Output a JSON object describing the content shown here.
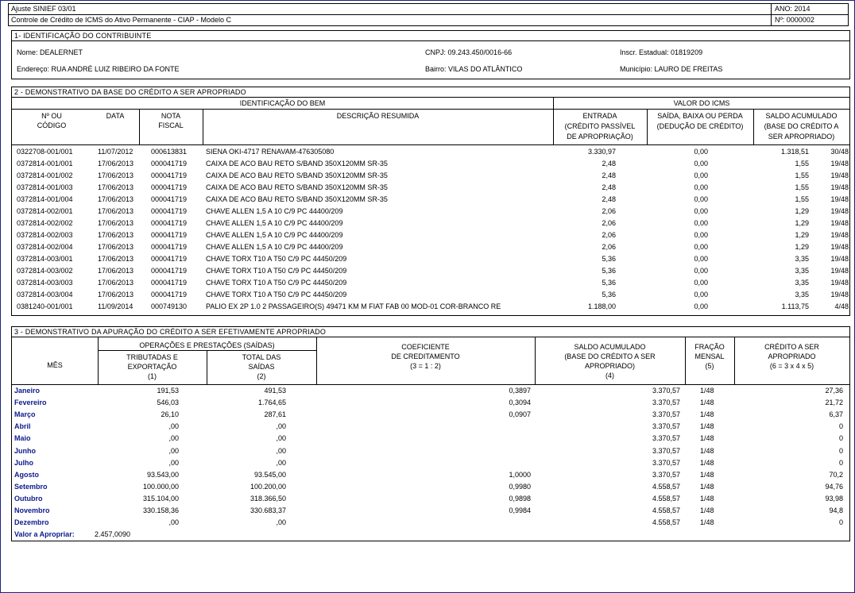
{
  "header": {
    "doc_ref": "Ajuste SINIEF 03/01",
    "doc_title": "Controle de Crédito de ICMS do Ativo Permanente - CIAP - Modelo C",
    "year": "ANO: 2014",
    "number": "Nº: 0000002"
  },
  "sec1": {
    "title": "1- IDENTIFICAÇÃO DO CONTRIBUINTE",
    "nome": "Nome: DEALERNET",
    "cnpj": "CNPJ: 09.243.450/0016-66",
    "inscr": "Inscr. Estadual: 01819209",
    "endereco": "Endereço: RUA ANDRÉ LUIZ RIBEIRO DA FONTE",
    "bairro": "Bairro: VILAS DO ATLÂNTICO",
    "municipio": "Município: LAURO DE FREITAS"
  },
  "sec2": {
    "title": "2 - DEMONSTRATIVO DA BASE DO CRÉDITO A SER APROPRIADO",
    "group_bem": "IDENTIFICAÇÃO DO BEM",
    "group_icms": "VALOR DO ICMS",
    "col_codigo": [
      "Nº OU",
      "CÓDIGO"
    ],
    "col_data": "DATA",
    "col_nota": [
      "NOTA",
      "FISCAL"
    ],
    "col_desc": "DESCRIÇÃO RESUMIDA",
    "col_entrada": [
      "ENTRADA",
      "(CRÉDITO PASSÍVEL",
      "DE APROPRIAÇÃO)"
    ],
    "col_saida": [
      "SAÍDA, BAIXA OU PERDA",
      "(DEDUÇÃO DE CRÉDITO)"
    ],
    "col_saldo": [
      "SALDO ACUMULADO",
      "(BASE DO CRÉDITO A",
      "SER APROPRIADO)"
    ],
    "rows": [
      {
        "codigo": "0322708-001/001",
        "data": "11/07/2012",
        "nota": "000613831",
        "desc": "SIENA OKI-4717 RENAVAM-476305080",
        "entrada": "3.330,97",
        "saida": "0,00",
        "saldo": "1.318,51",
        "fracao": "30/48"
      },
      {
        "codigo": "0372814-001/001",
        "data": "17/06/2013",
        "nota": "000041719",
        "desc": "CAIXA DE ACO BAU RETO S/BAND 350X120MM SR-35",
        "entrada": "2,48",
        "saida": "0,00",
        "saldo": "1,55",
        "fracao": "19/48"
      },
      {
        "codigo": "0372814-001/002",
        "data": "17/06/2013",
        "nota": "000041719",
        "desc": "CAIXA DE ACO BAU RETO S/BAND 350X120MM SR-35",
        "entrada": "2,48",
        "saida": "0,00",
        "saldo": "1,55",
        "fracao": "19/48"
      },
      {
        "codigo": "0372814-001/003",
        "data": "17/06/2013",
        "nota": "000041719",
        "desc": "CAIXA DE ACO BAU RETO S/BAND 350X120MM SR-35",
        "entrada": "2,48",
        "saida": "0,00",
        "saldo": "1,55",
        "fracao": "19/48"
      },
      {
        "codigo": "0372814-001/004",
        "data": "17/06/2013",
        "nota": "000041719",
        "desc": "CAIXA DE ACO BAU RETO S/BAND 350X120MM SR-35",
        "entrada": "2,48",
        "saida": "0,00",
        "saldo": "1,55",
        "fracao": "19/48"
      },
      {
        "codigo": "0372814-002/001",
        "data": "17/06/2013",
        "nota": "000041719",
        "desc": "CHAVE ALLEN 1,5 A 10 C/9 PC 44400/209",
        "entrada": "2,06",
        "saida": "0,00",
        "saldo": "1,29",
        "fracao": "19/48"
      },
      {
        "codigo": "0372814-002/002",
        "data": "17/06/2013",
        "nota": "000041719",
        "desc": "CHAVE ALLEN 1,5 A 10 C/9 PC 44400/209",
        "entrada": "2,06",
        "saida": "0,00",
        "saldo": "1,29",
        "fracao": "19/48"
      },
      {
        "codigo": "0372814-002/003",
        "data": "17/06/2013",
        "nota": "000041719",
        "desc": "CHAVE ALLEN 1,5 A 10 C/9 PC 44400/209",
        "entrada": "2,06",
        "saida": "0,00",
        "saldo": "1,29",
        "fracao": "19/48"
      },
      {
        "codigo": "0372814-002/004",
        "data": "17/06/2013",
        "nota": "000041719",
        "desc": "CHAVE ALLEN 1,5 A 10 C/9 PC 44400/209",
        "entrada": "2,06",
        "saida": "0,00",
        "saldo": "1,29",
        "fracao": "19/48"
      },
      {
        "codigo": "0372814-003/001",
        "data": "17/06/2013",
        "nota": "000041719",
        "desc": "CHAVE TORX T10 A T50 C/9 PC 44450/209",
        "entrada": "5,36",
        "saida": "0,00",
        "saldo": "3,35",
        "fracao": "19/48"
      },
      {
        "codigo": "0372814-003/002",
        "data": "17/06/2013",
        "nota": "000041719",
        "desc": "CHAVE TORX T10 A T50 C/9 PC 44450/209",
        "entrada": "5,36",
        "saida": "0,00",
        "saldo": "3,35",
        "fracao": "19/48"
      },
      {
        "codigo": "0372814-003/003",
        "data": "17/06/2013",
        "nota": "000041719",
        "desc": "CHAVE TORX T10 A T50 C/9 PC 44450/209",
        "entrada": "5,36",
        "saida": "0,00",
        "saldo": "3,35",
        "fracao": "19/48"
      },
      {
        "codigo": "0372814-003/004",
        "data": "17/06/2013",
        "nota": "000041719",
        "desc": "CHAVE TORX T10 A T50 C/9 PC 44450/209",
        "entrada": "5,36",
        "saida": "0,00",
        "saldo": "3,35",
        "fracao": "19/48"
      },
      {
        "codigo": "0381240-001/001",
        "data": "11/09/2014",
        "nota": "000749130",
        "desc": "PALIO EX 2P 1.0 2   PASSAGEIRO(S)  49471 KM M FIAT FAB 00  MOD-01 COR-BRANCO RE",
        "entrada": "1.188,00",
        "saida": "0,00",
        "saldo": "1.113,75",
        "fracao": "4/48"
      }
    ]
  },
  "sec3": {
    "title": "3 - DEMONSTRATIVO DA APURAÇÃO DO CRÉDITO A SER EFETIVAMENTE APROPRIADO",
    "col_mes": "MÊS",
    "group_ops": "OPERAÇÕES E PRESTAÇÕES (SAÍDAS)",
    "col_trib": [
      "TRIBUTADAS E",
      "EXPORTAÇÃO",
      "(1)"
    ],
    "col_total": [
      "TOTAL DAS",
      "SAÍDAS",
      "(2)"
    ],
    "col_coef": [
      "COEFICIENTE",
      "DE CREDITAMENTO",
      "(3 = 1 : 2)"
    ],
    "col_saldo": [
      "SALDO ACUMULADO",
      "(BASE DO CRÉDITO A SER",
      "APROPRIADO)",
      "(4)"
    ],
    "col_fracao": [
      "FRAÇÃO",
      "MENSAL",
      "(5)"
    ],
    "col_credito": [
      "CRÉDITO A SER",
      "APROPRIADO",
      "(6 = 3 x 4 x 5)"
    ],
    "rows": [
      {
        "mes": "Janeiro",
        "trib": "191,53",
        "total": "491,53",
        "coef": "0,3897",
        "saldo": "3.370,57",
        "fracao": "1/48",
        "credito": "27,36"
      },
      {
        "mes": "Fevereiro",
        "trib": "546,03",
        "total": "1.764,65",
        "coef": "0,3094",
        "saldo": "3.370,57",
        "fracao": "1/48",
        "credito": "21,72"
      },
      {
        "mes": "Março",
        "trib": "26,10",
        "total": "287,61",
        "coef": "0,0907",
        "saldo": "3.370,57",
        "fracao": "1/48",
        "credito": "6,37"
      },
      {
        "mes": "Abril",
        "trib": ",00",
        "total": ",00",
        "coef": "",
        "saldo": "3.370,57",
        "fracao": "1/48",
        "credito": "0"
      },
      {
        "mes": "Maio",
        "trib": ",00",
        "total": ",00",
        "coef": "",
        "saldo": "3.370,57",
        "fracao": "1/48",
        "credito": "0"
      },
      {
        "mes": "Junho",
        "trib": ",00",
        "total": ",00",
        "coef": "",
        "saldo": "3.370,57",
        "fracao": "1/48",
        "credito": "0"
      },
      {
        "mes": "Julho",
        "trib": ",00",
        "total": ",00",
        "coef": "",
        "saldo": "3.370,57",
        "fracao": "1/48",
        "credito": "0"
      },
      {
        "mes": "Agosto",
        "trib": "93.543,00",
        "total": "93.545,00",
        "coef": "1,0000",
        "saldo": "3.370,57",
        "fracao": "1/48",
        "credito": "70,2"
      },
      {
        "mes": "Setembro",
        "trib": "100.000,00",
        "total": "100.200,00",
        "coef": "0,9980",
        "saldo": "4.558,57",
        "fracao": "1/48",
        "credito": "94,76"
      },
      {
        "mes": "Outubro",
        "trib": "315.104,00",
        "total": "318.366,50",
        "coef": "0,9898",
        "saldo": "4.558,57",
        "fracao": "1/48",
        "credito": "93,98"
      },
      {
        "mes": "Novembro",
        "trib": "330.158,36",
        "total": "330.683,37",
        "coef": "0,9984",
        "saldo": "4.558,57",
        "fracao": "1/48",
        "credito": "94,8"
      },
      {
        "mes": "Dezembro",
        "trib": ",00",
        "total": ",00",
        "coef": "",
        "saldo": "4.558,57",
        "fracao": "1/48",
        "credito": "0"
      }
    ],
    "valor_label": "Valor a Apropriar:",
    "valor": "2.457,0090"
  },
  "colors": {
    "frame": "#1a237e",
    "month_text": "#0d1a8c"
  }
}
